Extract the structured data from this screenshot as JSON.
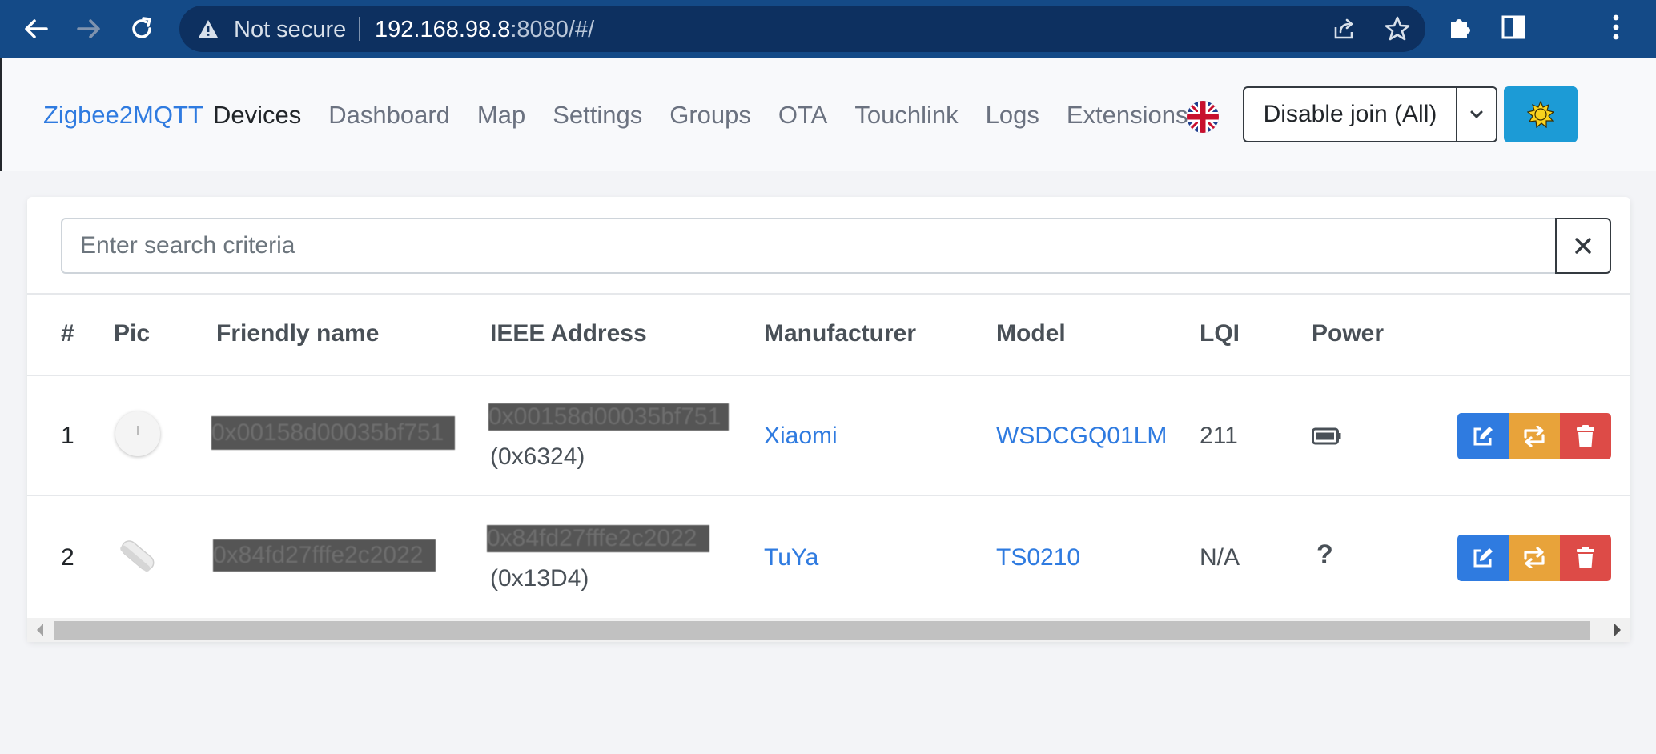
{
  "browser": {
    "security_label": "Not secure",
    "url_host": "192.168.98.8",
    "url_rest": ":8080/#/"
  },
  "app": {
    "brand": "Zigbee2MQTT",
    "nav": [
      "Devices",
      "Dashboard",
      "Map",
      "Settings",
      "Groups",
      "OTA",
      "Touchlink",
      "Logs",
      "Extensions"
    ],
    "active_nav": "Devices",
    "join_button": "Disable join (All)",
    "theme_icon": "sun-icon"
  },
  "search": {
    "placeholder": "Enter search criteria"
  },
  "table": {
    "headers": [
      "#",
      "Pic",
      "Friendly name",
      "IEEE Address",
      "Manufacturer",
      "Model",
      "LQI",
      "Power"
    ],
    "rows": [
      {
        "index": "1",
        "friendly_name": "0x00158d00035bf751",
        "ieee_address": "0x00158d00035bf751",
        "network_address": "(0x6324)",
        "manufacturer": "Xiaomi",
        "model": "WSDCGQ01LM",
        "lqi": "211",
        "power_icon": "battery-icon"
      },
      {
        "index": "2",
        "friendly_name": "0x84fd27fffe2c2022",
        "ieee_address": "0x84fd27fffe2c2022",
        "network_address": "(0x13D4)",
        "manufacturer": "TuYa",
        "model": "TS0210",
        "lqi": "N/A",
        "power_text": "?"
      }
    ]
  },
  "colors": {
    "chrome": "#144a87",
    "link": "#2f7be0",
    "edit": "#2f7be0",
    "swap": "#e8a33a",
    "delete": "#dd4b47",
    "theme": "#1c9bd6"
  }
}
